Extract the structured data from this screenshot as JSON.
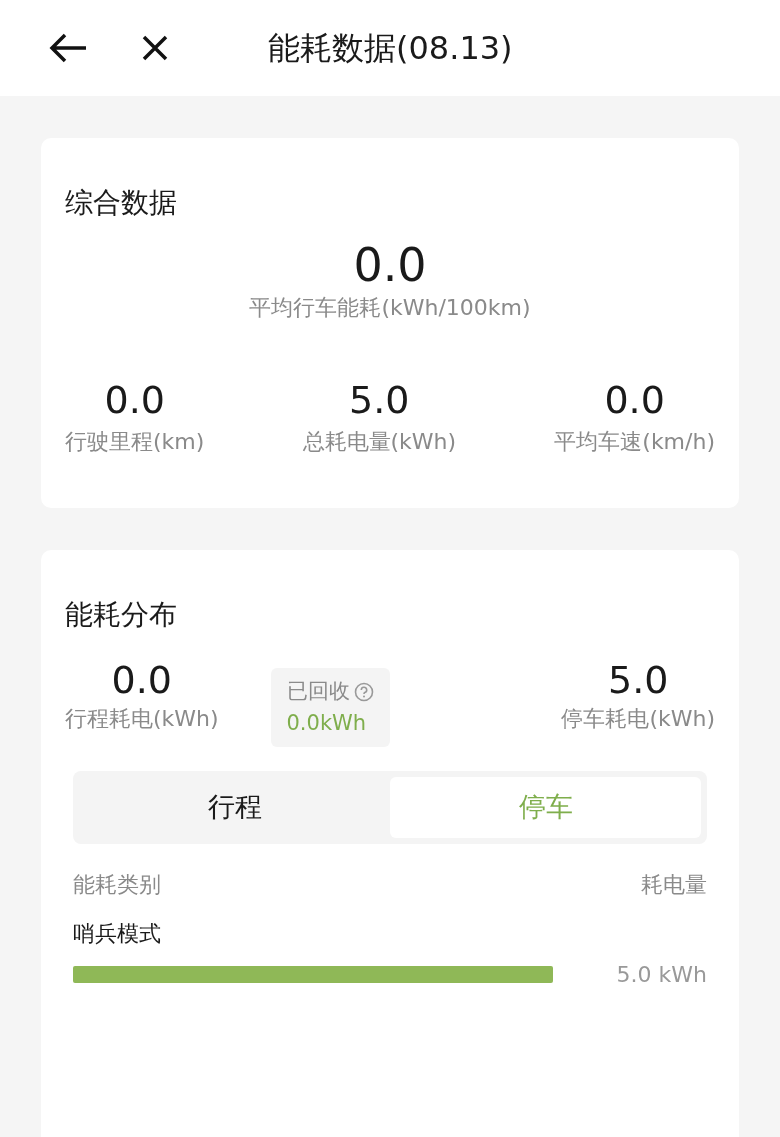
{
  "header": {
    "title": "能耗数据(08.13)"
  },
  "summary": {
    "title": "综合数据",
    "main": {
      "value": "0.0",
      "label": "平均行车能耗(kWh/100km)"
    },
    "stats": [
      {
        "value": "0.0",
        "label": "行驶里程(km)"
      },
      {
        "value": "5.0",
        "label": "总耗电量(kWh)"
      },
      {
        "value": "0.0",
        "label": "平均车速(km/h)"
      }
    ]
  },
  "distribution": {
    "title": "能耗分布",
    "drive": {
      "value": "0.0",
      "label": "行程耗电(kWh)"
    },
    "recovered": {
      "label": "已回收",
      "value": "0.0kWh"
    },
    "park": {
      "value": "5.0",
      "label": "停车耗电(kWh)"
    },
    "tabs": [
      {
        "label": "行程",
        "selected": false
      },
      {
        "label": "停车",
        "selected": true
      }
    ],
    "columns": [
      "能耗类别",
      "耗电量"
    ],
    "items": [
      {
        "name": "哨兵模式",
        "reading": "5.0 kWh"
      }
    ]
  }
}
